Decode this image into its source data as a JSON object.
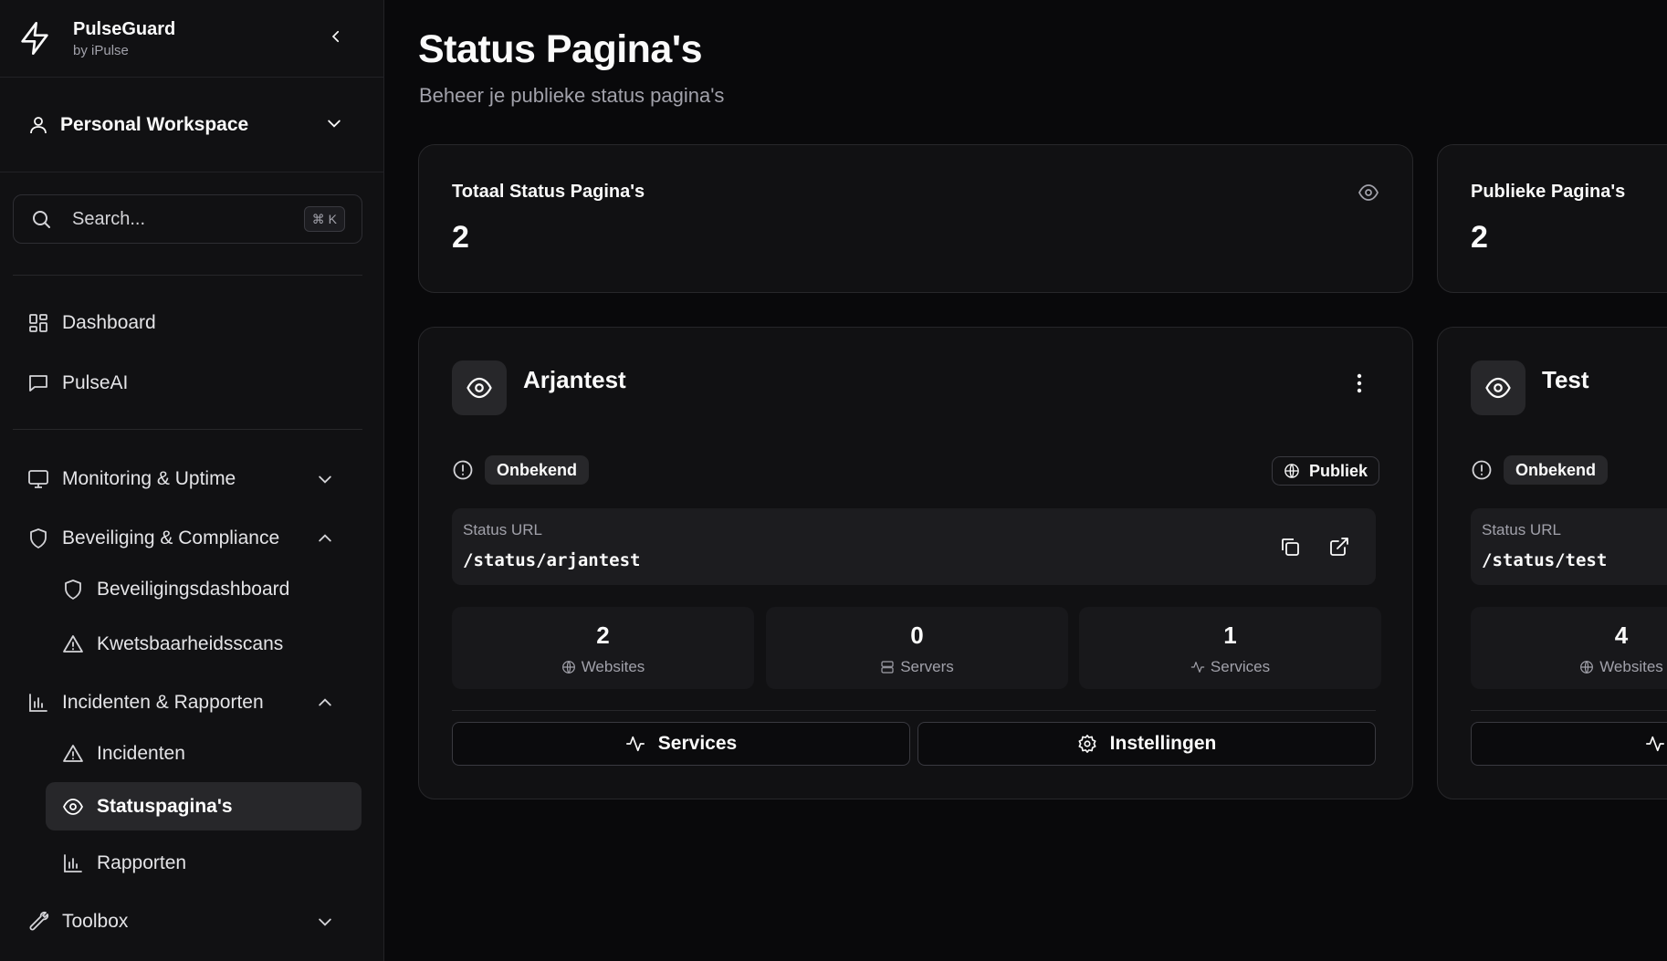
{
  "sidebar": {
    "brand": {
      "name": "PulseGuard",
      "sub": "by iPulse"
    },
    "workspace": {
      "label": "Personal Workspace"
    },
    "search": {
      "placeholder": "Search...",
      "shortcut": "⌘ K"
    },
    "top_items": [
      {
        "label": "Dashboard",
        "icon": "grid-icon"
      },
      {
        "label": "PulseAI",
        "icon": "chat-icon"
      }
    ],
    "groups": [
      {
        "label": "Monitoring & Uptime",
        "icon": "monitor-icon",
        "expanded": false
      },
      {
        "label": "Beveiliging & Compliance",
        "icon": "shield-icon",
        "expanded": true,
        "items": [
          {
            "label": "Beveiligingsdashboard",
            "icon": "shield-icon"
          },
          {
            "label": "Kwetsbaarheidsscans",
            "icon": "warning-icon"
          }
        ]
      },
      {
        "label": "Incidenten & Rapporten",
        "icon": "bar-chart-icon",
        "expanded": true,
        "items": [
          {
            "label": "Incidenten",
            "icon": "warning-icon"
          },
          {
            "label": "Statuspagina's",
            "icon": "eye-icon",
            "active": true
          },
          {
            "label": "Rapporten",
            "icon": "bar-chart-icon"
          }
        ]
      },
      {
        "label": "Toolbox",
        "icon": "wrench-icon",
        "expanded": false
      }
    ]
  },
  "header": {
    "title": "Status Pagina's",
    "subtitle": "Beheer je publieke status pagina's"
  },
  "stats": [
    {
      "title": "Totaal Status Pagina's",
      "value": "2",
      "icon": "eye-icon"
    },
    {
      "title": "Publieke Pagina's",
      "value": "2"
    }
  ],
  "status_pages": [
    {
      "name": "Arjantest",
      "status": "Onbekend",
      "visibility": "Publiek",
      "url_label": "Status URL",
      "url": "/status/arjantest",
      "metrics": [
        {
          "value": "2",
          "label": "Websites",
          "icon": "globe-icon"
        },
        {
          "value": "0",
          "label": "Servers",
          "icon": "server-icon"
        },
        {
          "value": "1",
          "label": "Services",
          "icon": "activity-icon"
        }
      ],
      "actions": {
        "services": "Services",
        "settings": "Instellingen"
      }
    },
    {
      "name": "Test",
      "status": "Onbekend",
      "url_label": "Status URL",
      "url": "/status/test",
      "metrics": [
        {
          "value": "4",
          "label": "Websites",
          "icon": "globe-icon"
        }
      ]
    }
  ],
  "colors": {
    "background": "#09090b",
    "sidebar": "#111113",
    "card": "#111113",
    "border": "#27272a",
    "muted_text": "#a1a1aa",
    "active_item": "#27272a"
  }
}
